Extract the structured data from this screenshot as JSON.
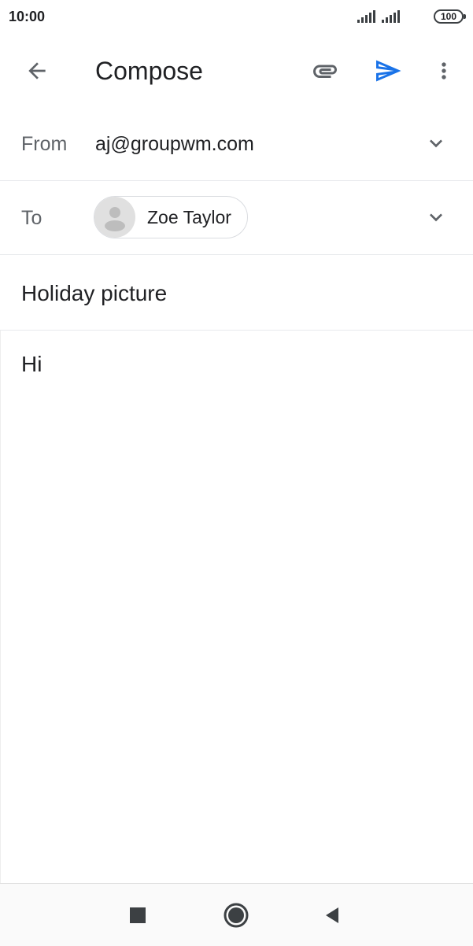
{
  "status_bar": {
    "time": "10:00",
    "battery": "100"
  },
  "app_bar": {
    "title": "Compose",
    "icons": {
      "back": "arrow-back-icon",
      "attach": "paperclip-icon",
      "send": "send-icon",
      "more": "more-vert-icon"
    },
    "accent_color": "#1a73e8"
  },
  "compose": {
    "from_label": "From",
    "from_value": "aj@groupwm.com",
    "to_label": "To",
    "recipients": [
      {
        "name": "Zoe Taylor"
      }
    ],
    "subject": "Holiday picture",
    "body": "Hi"
  },
  "nav_bar": {
    "icons": [
      "recents-square-icon",
      "home-circle-icon",
      "back-triangle-icon"
    ]
  }
}
